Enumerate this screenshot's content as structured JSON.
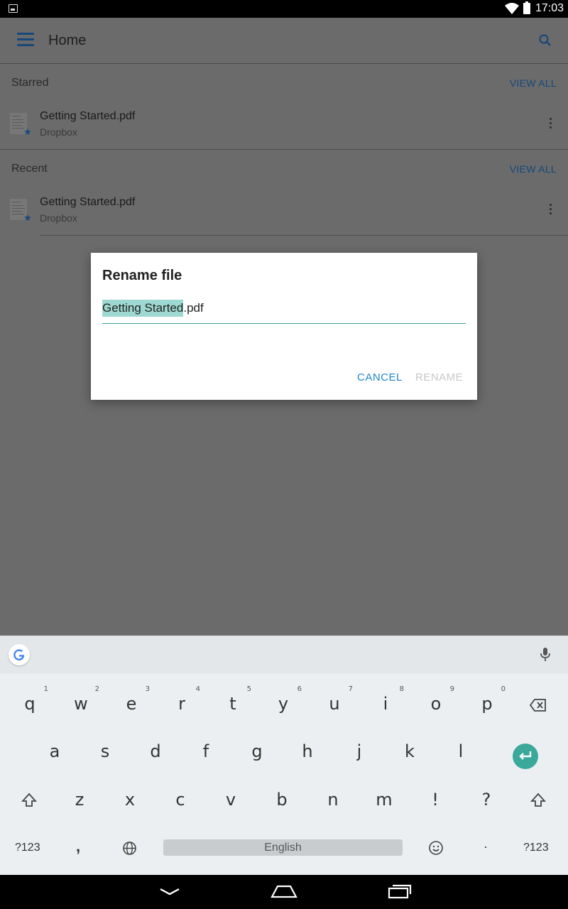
{
  "status_bar": {
    "time": "17:03"
  },
  "toolbar": {
    "title": "Home"
  },
  "starred": {
    "title": "Starred",
    "view_all": "VIEW ALL",
    "file": {
      "name": "Getting Started.pdf",
      "source": "Dropbox"
    }
  },
  "recent": {
    "title": "Recent",
    "view_all": "VIEW ALL",
    "file": {
      "name": "Getting Started.pdf",
      "source": "Dropbox"
    }
  },
  "dialog": {
    "title": "Rename file",
    "field_selected": "Getting Started",
    "field_rest": ".pdf",
    "cancel": "CANCEL",
    "rename": "RENAME"
  },
  "keyboard": {
    "row1": [
      "q",
      "w",
      "e",
      "r",
      "t",
      "y",
      "u",
      "i",
      "o",
      "p"
    ],
    "row1_hints": [
      "1",
      "2",
      "3",
      "4",
      "5",
      "6",
      "7",
      "8",
      "9",
      "0"
    ],
    "row2": [
      "a",
      "s",
      "d",
      "f",
      "g",
      "h",
      "j",
      "k",
      "l"
    ],
    "row3": [
      "z",
      "x",
      "c",
      "v",
      "b",
      "n",
      "m",
      "!",
      "?"
    ],
    "symbols_left": "?123",
    "comma": ",",
    "space_label": "English",
    "period": "·",
    "symbols_right": "?123"
  },
  "colors": {
    "accent_blue": "#1e88c8",
    "brand_dark_blue": "#16487a",
    "teal": "#3aa89a"
  }
}
